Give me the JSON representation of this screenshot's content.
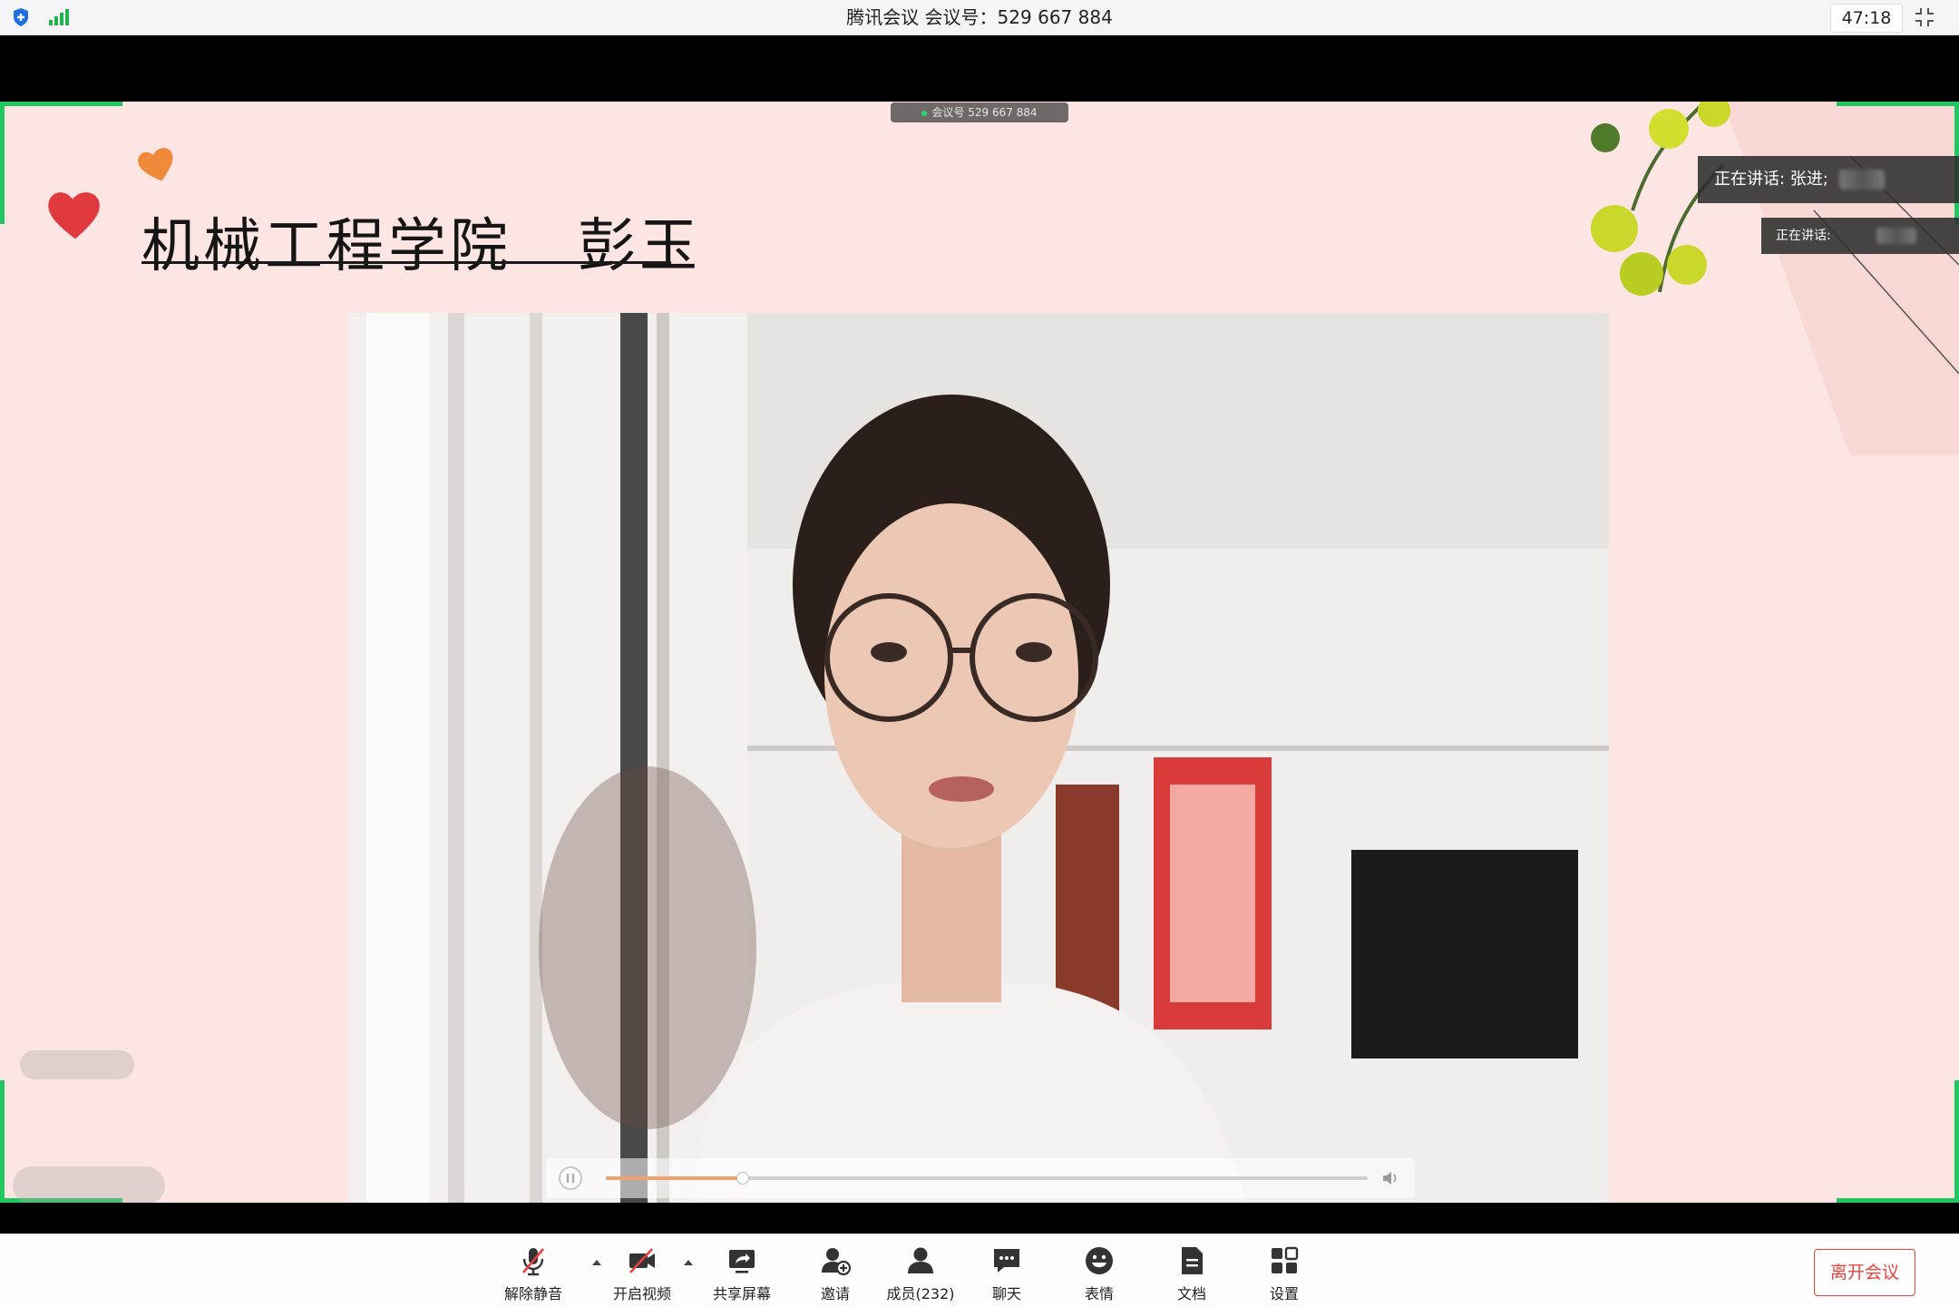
{
  "window": {
    "title": "腾讯会议 会议号：529 667 884",
    "timer": "47:18"
  },
  "share": {
    "meeting_pill": "会议号 529 667 884",
    "slide_title": "机械工程学院   彭玉",
    "speaking_main": "正在讲话: 张进;",
    "speaking_secondary": "正在讲话:",
    "accent_color": "#1ec85e"
  },
  "video_player": {
    "progress_fraction": 0.18,
    "playing": true
  },
  "toolbar": {
    "mute_label": "解除静音",
    "video_label": "开启视频",
    "share_label": "共享屏幕",
    "invite_label": "邀请",
    "members_label": "成员(232)",
    "chat_label": "聊天",
    "emoji_label": "表情",
    "docs_label": "文档",
    "settings_label": "设置",
    "leave_label": "离开会议",
    "leave_color": "#e8413c"
  },
  "icons": [
    "shield-icon",
    "signal-icon",
    "fullscreen-icon",
    "mic-muted-icon",
    "video-off-icon",
    "share-screen-icon",
    "invite-icon",
    "members-icon",
    "chat-icon",
    "emoji-icon",
    "document-icon",
    "settings-icon",
    "pause-icon",
    "volume-icon",
    "heart-icon"
  ]
}
